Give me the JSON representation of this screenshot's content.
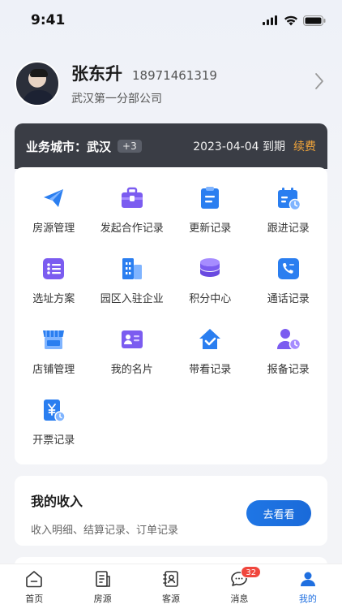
{
  "status_bar": {
    "time": "9:41"
  },
  "profile": {
    "name": "张东升",
    "phone": "18971461319",
    "company": "武汉第一分部公司"
  },
  "city_bar": {
    "label": "业务城市：武汉",
    "more": "+3",
    "expire": "2023-04-04 到期",
    "renew": "续费"
  },
  "menu": {
    "items": [
      {
        "label": "房源管理",
        "icon": "paper-plane-icon"
      },
      {
        "label": "发起合作记录",
        "icon": "briefcase-icon"
      },
      {
        "label": "更新记录",
        "icon": "clipboard-icon"
      },
      {
        "label": "跟进记录",
        "icon": "calendar-clock-icon"
      },
      {
        "label": "选址方案",
        "icon": "list-icon"
      },
      {
        "label": "园区入驻企业",
        "icon": "buildings-icon"
      },
      {
        "label": "积分中心",
        "icon": "coin-stack-icon"
      },
      {
        "label": "通话记录",
        "icon": "phone-icon"
      },
      {
        "label": "店铺管理",
        "icon": "store-icon"
      },
      {
        "label": "我的名片",
        "icon": "id-card-icon"
      },
      {
        "label": "带看记录",
        "icon": "house-check-icon"
      },
      {
        "label": "报备记录",
        "icon": "person-clock-icon"
      },
      {
        "label": "开票记录",
        "icon": "invoice-icon"
      }
    ]
  },
  "income": {
    "title": "我的收入",
    "subtitle": "收入明细、结算记录、订单记录",
    "button": "去看看"
  },
  "tabbar": {
    "items": [
      {
        "label": "首页",
        "icon": "home-icon"
      },
      {
        "label": "房源",
        "icon": "building-doc-icon"
      },
      {
        "label": "客源",
        "icon": "contact-book-icon"
      },
      {
        "label": "消息",
        "icon": "chat-icon",
        "badge": "32"
      },
      {
        "label": "我的",
        "icon": "person-icon",
        "active": true
      }
    ]
  },
  "colors": {
    "accent": "#1f6fe0",
    "renew": "#f2a53a",
    "badge": "#f0463d",
    "icon_blue": "#2a7ef0",
    "icon_purple": "#7b5cf0"
  }
}
